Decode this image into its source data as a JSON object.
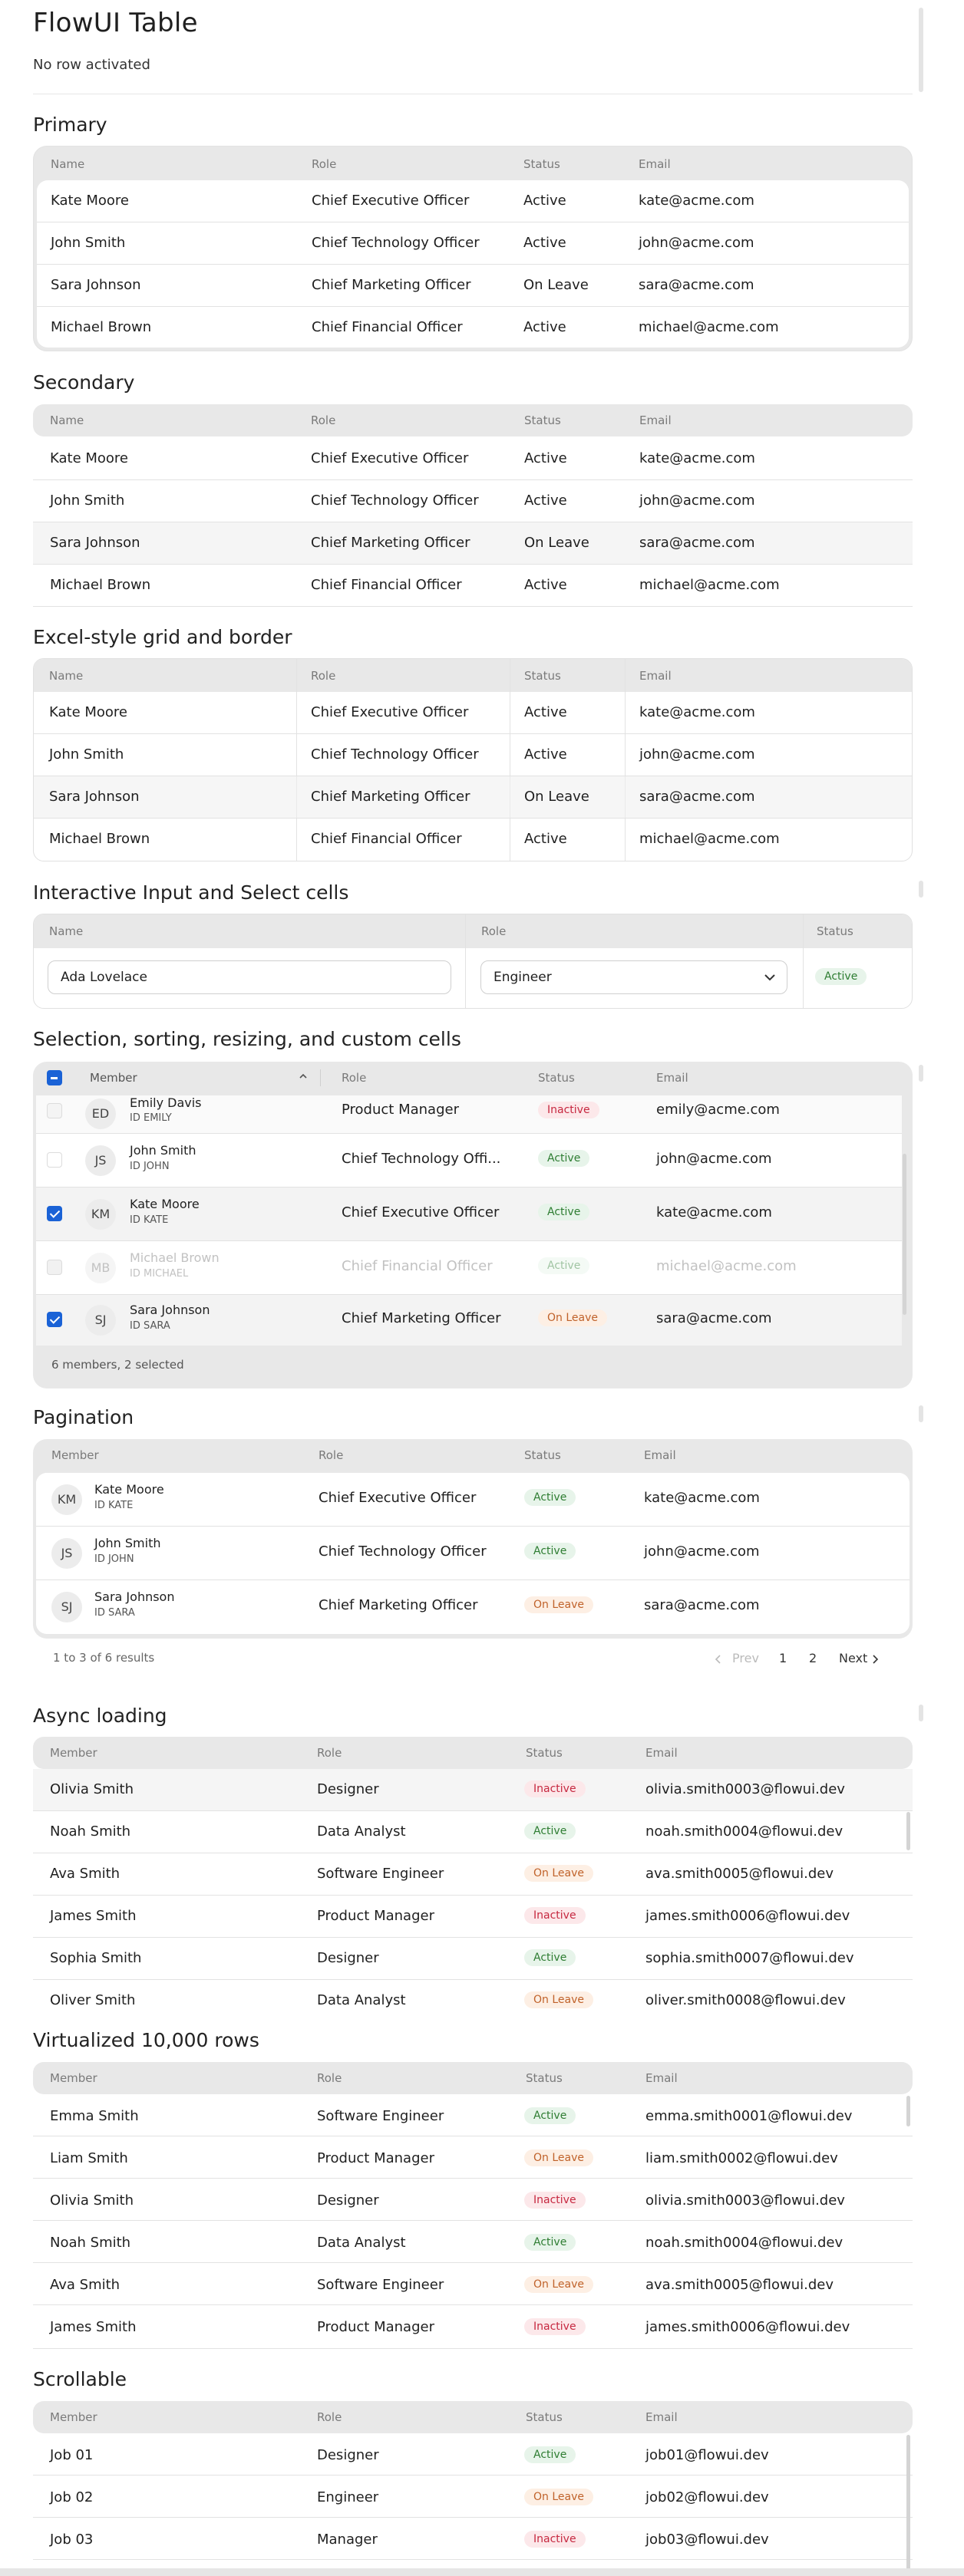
{
  "page": {
    "title": "FlowUI Table",
    "status": "No row activated"
  },
  "colors": {
    "active_bg": "#e7f4ea",
    "leave_bg": "#fdefe4",
    "inactive_bg": "#fce8ea",
    "accent": "#1a62d6"
  },
  "columns": {
    "name": "Name",
    "member": "Member",
    "role": "Role",
    "status": "Status",
    "email": "Email"
  },
  "people": [
    {
      "name": "Kate Moore",
      "role": "Chief Executive Officer",
      "status": "Active",
      "email": "kate@acme.com"
    },
    {
      "name": "John Smith",
      "role": "Chief Technology Officer",
      "status": "Active",
      "email": "john@acme.com"
    },
    {
      "name": "Sara Johnson",
      "role": "Chief Marketing Officer",
      "status": "On Leave",
      "email": "sara@acme.com"
    },
    {
      "name": "Michael Brown",
      "role": "Chief Financial Officer",
      "status": "Active",
      "email": "michael@acme.com"
    }
  ],
  "sections": {
    "primary": "Primary",
    "secondary": "Secondary",
    "excel": "Excel-style grid and border",
    "interactive": "Interactive Input and Select cells",
    "selection": "Selection, sorting, resizing, and custom cells",
    "pagination": "Pagination",
    "async": "Async loading",
    "virtual": "Virtualized 10,000 rows",
    "scrollable": "Scrollable"
  },
  "interactive": {
    "name_value": "Ada Lovelace",
    "role_value": "Engineer",
    "status": "Active"
  },
  "selection": {
    "rows": [
      {
        "initials": "ED",
        "name": "Emily Davis",
        "id": "ID EMILY",
        "role": "Product Manager",
        "status": "Inactive",
        "email": "emily@acme.com"
      },
      {
        "initials": "JS",
        "name": "John Smith",
        "id": "ID JOHN",
        "role": "Chief Technology Offi...",
        "status": "Active",
        "email": "john@acme.com"
      },
      {
        "initials": "KM",
        "name": "Kate Moore",
        "id": "ID KATE",
        "role": "Chief Executive Officer",
        "status": "Active",
        "email": "kate@acme.com"
      },
      {
        "initials": "MB",
        "name": "Michael Brown",
        "id": "ID MICHAEL",
        "role": "Chief Financial Officer",
        "status": "Active",
        "email": "michael@acme.com"
      },
      {
        "initials": "SJ",
        "name": "Sara Johnson",
        "id": "ID SARA",
        "role": "Chief Marketing Officer",
        "status": "On Leave",
        "email": "sara@acme.com"
      }
    ],
    "footer": "6 members, 2 selected"
  },
  "pagination": {
    "rows": [
      {
        "initials": "KM",
        "name": "Kate Moore",
        "id": "ID KATE",
        "role": "Chief Executive Officer",
        "status": "Active",
        "email": "kate@acme.com"
      },
      {
        "initials": "JS",
        "name": "John Smith",
        "id": "ID JOHN",
        "role": "Chief Technology Officer",
        "status": "Active",
        "email": "john@acme.com"
      },
      {
        "initials": "SJ",
        "name": "Sara Johnson",
        "id": "ID SARA",
        "role": "Chief Marketing Officer",
        "status": "On Leave",
        "email": "sara@acme.com"
      }
    ],
    "summary": "1 to 3 of 6 results",
    "prev": "Prev",
    "page1": "1",
    "page2": "2",
    "next": "Next"
  },
  "async": [
    {
      "name": "Olivia Smith",
      "role": "Designer",
      "status": "Inactive",
      "email": "olivia.smith0003@flowui.dev"
    },
    {
      "name": "Noah Smith",
      "role": "Data Analyst",
      "status": "Active",
      "email": "noah.smith0004@flowui.dev"
    },
    {
      "name": "Ava Smith",
      "role": "Software Engineer",
      "status": "On Leave",
      "email": "ava.smith0005@flowui.dev"
    },
    {
      "name": "James Smith",
      "role": "Product Manager",
      "status": "Inactive",
      "email": "james.smith0006@flowui.dev"
    },
    {
      "name": "Sophia Smith",
      "role": "Designer",
      "status": "Active",
      "email": "sophia.smith0007@flowui.dev"
    },
    {
      "name": "Oliver Smith",
      "role": "Data Analyst",
      "status": "On Leave",
      "email": "oliver.smith0008@flowui.dev"
    }
  ],
  "virtual": [
    {
      "name": "Emma Smith",
      "role": "Software Engineer",
      "status": "Active",
      "email": "emma.smith0001@flowui.dev"
    },
    {
      "name": "Liam Smith",
      "role": "Product Manager",
      "status": "On Leave",
      "email": "liam.smith0002@flowui.dev"
    },
    {
      "name": "Olivia Smith",
      "role": "Designer",
      "status": "Inactive",
      "email": "olivia.smith0003@flowui.dev"
    },
    {
      "name": "Noah Smith",
      "role": "Data Analyst",
      "status": "Active",
      "email": "noah.smith0004@flowui.dev"
    },
    {
      "name": "Ava Smith",
      "role": "Software Engineer",
      "status": "On Leave",
      "email": "ava.smith0005@flowui.dev"
    },
    {
      "name": "James Smith",
      "role": "Product Manager",
      "status": "Inactive",
      "email": "james.smith0006@flowui.dev"
    }
  ],
  "scrollable": [
    {
      "name": "Job 01",
      "role": "Designer",
      "status": "Active",
      "email": "job01@flowui.dev"
    },
    {
      "name": "Job 02",
      "role": "Engineer",
      "status": "On Leave",
      "email": "job02@flowui.dev"
    },
    {
      "name": "Job 03",
      "role": "Manager",
      "status": "Inactive",
      "email": "job03@flowui.dev"
    }
  ]
}
